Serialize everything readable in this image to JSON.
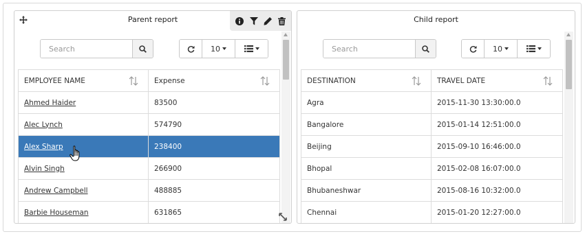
{
  "parent": {
    "title": "Parent report",
    "search_placeholder": "Search",
    "page_size": "10",
    "columns": [
      "EMPLOYEE NAME",
      "Expense"
    ],
    "rows": [
      [
        "Ahmed Haider",
        "83500"
      ],
      [
        "Alec Lynch",
        "574790"
      ],
      [
        "Alex Sharp",
        "238400"
      ],
      [
        "Alvin Singh",
        "266900"
      ],
      [
        "Andrew Campbell",
        "488885"
      ],
      [
        "Barbie Houseman",
        "631865"
      ]
    ],
    "selected_row": 2
  },
  "child": {
    "title": "Child report",
    "search_placeholder": "Search",
    "page_size": "10",
    "columns": [
      "DESTINATION",
      "TRAVEL DATE"
    ],
    "rows": [
      [
        "Agra",
        "2015-11-30 13:30:00.0"
      ],
      [
        "Bangalore",
        "2015-01-14 12:51:00.0"
      ],
      [
        "Beijing",
        "2015-09-10 16:46:00.0"
      ],
      [
        "Bhopal",
        "2015-02-08 16:07:00.0"
      ],
      [
        "Bhubaneshwar",
        "2015-08-16 10:32:00.0"
      ],
      [
        "Chennai",
        "2015-01-20 12:27:00.0"
      ]
    ]
  },
  "colors": {
    "selected_row": "#3a79b8",
    "toolbar_bg": "#ebebeb"
  },
  "icons": {
    "move": "move-icon",
    "toolbar": [
      "info-icon",
      "filter-icon",
      "edit-icon",
      "trash-icon"
    ],
    "refresh": "refresh-icon",
    "columns": "list-icon",
    "search": "search-icon",
    "sort": "sort-icon",
    "resize": "resize-icon"
  }
}
